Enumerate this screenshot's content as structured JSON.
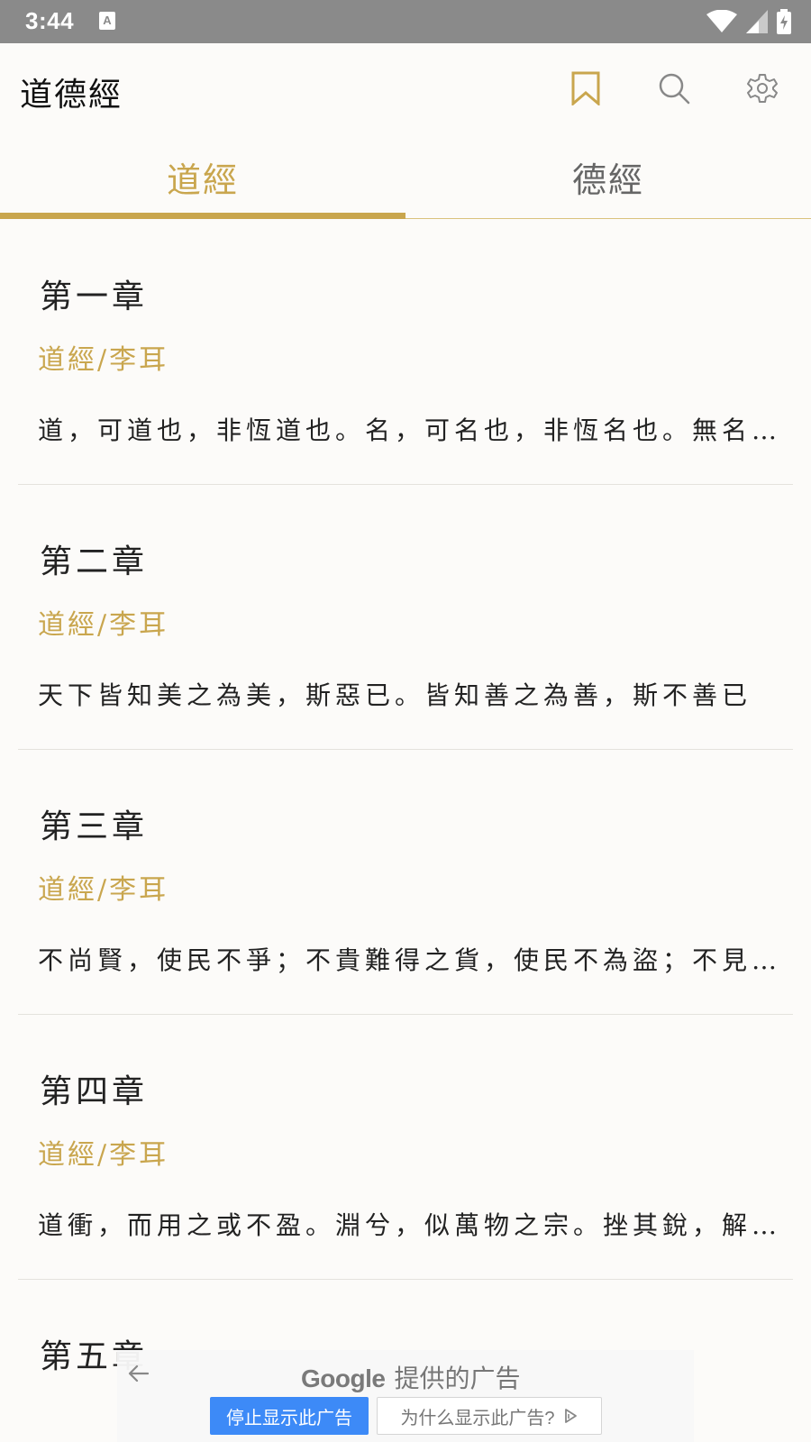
{
  "status_bar": {
    "time": "3:44",
    "notification_letter": "A"
  },
  "app_bar": {
    "title": "道德經"
  },
  "tabs": [
    {
      "label": "道經",
      "active": true
    },
    {
      "label": "德經",
      "active": false
    }
  ],
  "colors": {
    "accent": "#c9a64e",
    "background": "#fcfbf9",
    "status_bar": "#8a8a8a",
    "ad_button": "#3d8af7"
  },
  "chapters": [
    {
      "title": "第一章",
      "source": "道經/李耳",
      "excerpt": "道，可道也，非恆道也。名，可名也，非恆名也。無名，萬物之始也"
    },
    {
      "title": "第二章",
      "source": "道經/李耳",
      "excerpt": "天下皆知美之為美，斯惡已。皆知善之為善，斯不善已"
    },
    {
      "title": "第三章",
      "source": "道經/李耳",
      "excerpt": "不尚賢，使民不爭；不貴難得之貨，使民不為盜；不見可欲"
    },
    {
      "title": "第四章",
      "source": "道經/李耳",
      "excerpt": "道衝，而用之或不盈。淵兮，似萬物之宗。挫其銳，解其紛"
    },
    {
      "title": "第五章"
    }
  ],
  "ad": {
    "brand": "Google",
    "brand_suffix": "提供的广告",
    "stop_label": "停止显示此广告",
    "why_label": "为什么显示此广告?"
  }
}
